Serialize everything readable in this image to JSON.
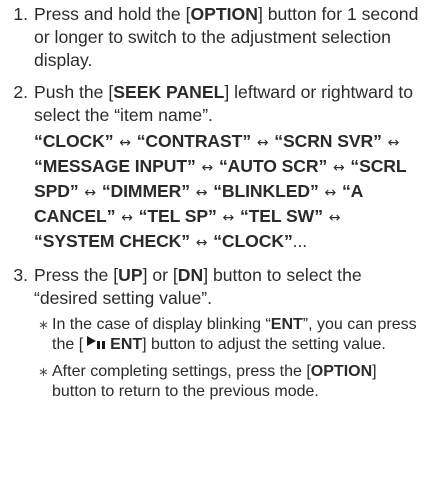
{
  "steps": [
    {
      "num": "1.",
      "text_a": "Press and hold the [",
      "btn": "OPTION",
      "text_b": "] button for 1 second or longer to switch to the adjustment selection display."
    },
    {
      "num": "2.",
      "text_a": "Push the [",
      "btn": "SEEK PANEL",
      "text_b": "] leftward or rightward to select the “item name”.",
      "cycle": {
        "items": [
          "CLOCK",
          "CONTRAST",
          "SCRN SVR",
          "MESSAGE INPUT",
          "AUTO SCR",
          "SCRL SPD",
          "DIMMER",
          "BLINKLED",
          "A CANCEL",
          "TEL SP",
          "TEL SW",
          "SYSTEM CHECK",
          "CLOCK"
        ],
        "arrow": "↔",
        "open_quote": "“",
        "close_quote": "”",
        "ellipsis": "..."
      }
    },
    {
      "num": "3.",
      "text_a": "Press the [",
      "btn_up": "UP",
      "text_mid": "] or [",
      "btn_dn": "DN",
      "text_b": "] button to select the “desired setting value”.",
      "notes": [
        {
          "mark": "∗",
          "text_a": "In the case of display blinking “",
          "bold": "ENT",
          "text_b": "”, you can press the [",
          "btn_label": "ENT",
          "text_c": "] button to adjust the setting value.",
          "icon": "play-pause-icon"
        },
        {
          "mark": "∗",
          "text_a": "After completing settings, press the [",
          "bold": "OPTION",
          "text_b": "] button to return to the previous mode."
        }
      ]
    }
  ]
}
